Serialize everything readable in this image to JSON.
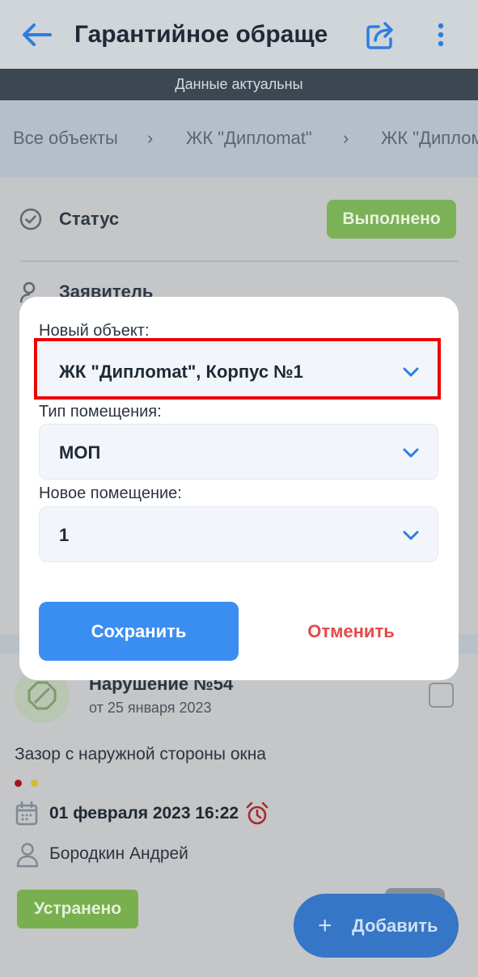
{
  "header": {
    "title": "Гарантийное обраще",
    "status": "Данные актуальны",
    "icons": [
      "back-arrow-icon",
      "share-icon",
      "more-vertical-icon"
    ]
  },
  "breadcrumbs": [
    "Все объекты",
    "ЖК \"Диплomat\"",
    "ЖК \"Диплом"
  ],
  "details": {
    "status_label": "Статус",
    "status_value": "Выполнено",
    "applicant_label": "Заявитель"
  },
  "dialog": {
    "object_label": "Новый объект:",
    "object_value": "ЖК \"Диплomat\", Корпус №1",
    "room_type_label": "Тип помещения:",
    "room_type_value": "МОП",
    "room_label": "Новое помещение:",
    "room_value": "1",
    "save_label": "Сохранить",
    "cancel_label": "Отменить"
  },
  "violation": {
    "title": "Нарушение №54",
    "date": "от 25 января 2023",
    "description": "Зазор с наружной стороны окна",
    "due": "01 февраля 2023 16:22",
    "assignee": "Бородкин Андрей",
    "state": "Устранено"
  },
  "fab": {
    "plus": "+",
    "label": "Добавить"
  },
  "colors": {
    "accent": "#3b8ef1",
    "success": "#7bb257",
    "danger": "#e34a4a",
    "highlight": "#ee0000"
  }
}
